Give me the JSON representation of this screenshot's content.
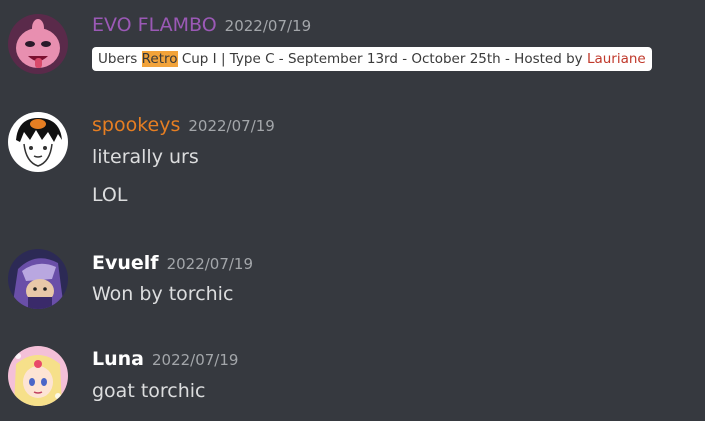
{
  "colors": {
    "background": "#36393f",
    "evo_name": "#9b59b6",
    "spookeys_name": "#e67e22",
    "white_name": "#ffffff",
    "timestamp": "#a3a6aa",
    "text": "#dcddde",
    "highlight": "#f2a33a",
    "host_link": "#c0392b"
  },
  "messages": [
    {
      "author": "EVO FLAMBO",
      "timestamp": "2022/07/19",
      "embed": {
        "before": "Ubers ",
        "highlight": "Retro",
        "after": " Cup I | Type C - September 13rd - October 25th - Hosted by ",
        "host": "Lauriane"
      }
    },
    {
      "author": "spookeys",
      "timestamp": "2022/07/19",
      "lines": [
        "literally urs",
        "LOL"
      ]
    },
    {
      "author": "Evuelf",
      "timestamp": "2022/07/19",
      "lines": [
        "Won by torchic"
      ]
    },
    {
      "author": "Luna",
      "timestamp": "2022/07/19",
      "lines": [
        "goat torchic"
      ]
    }
  ]
}
